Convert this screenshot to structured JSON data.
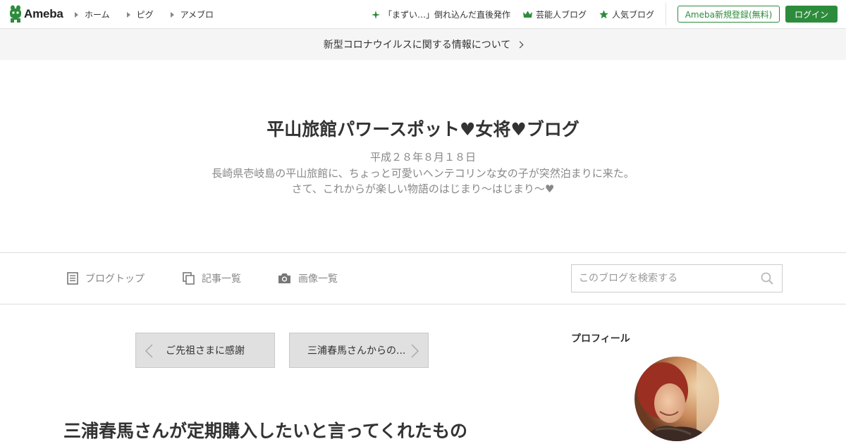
{
  "header": {
    "logo_text": "Ameba",
    "nav": [
      "ホーム",
      "ピグ",
      "アメブロ"
    ],
    "links": [
      {
        "label": "「まずい…」倒れ込んだ直後発作",
        "icon": "sparkle-icon"
      },
      {
        "label": "芸能人ブログ",
        "icon": "crown-icon"
      },
      {
        "label": "人気ブログ",
        "icon": "star-icon"
      }
    ],
    "register_label": "Ameba新規登録(無料)",
    "login_label": "ログイン"
  },
  "notice": {
    "text": "新型コロナウイルスに関する情報について"
  },
  "blog": {
    "title": "平山旅館パワースポット♥女将♥ブログ",
    "description": [
      "平成２８年８月１８日",
      "長崎県壱岐島の平山旅館に、ちょっと可愛いヘンテコリンな女の子が突然泊まりに来た。",
      "さて、これからが楽しい物語のはじまり～はじまり～♥"
    ]
  },
  "blognav": {
    "items": [
      {
        "label": "ブログトップ",
        "icon": "document-icon"
      },
      {
        "label": "記事一覧",
        "icon": "copy-icon"
      },
      {
        "label": "画像一覧",
        "icon": "camera-icon"
      }
    ],
    "search_placeholder": "このブログを検索する"
  },
  "pager": {
    "prev_label": "ご先祖さまに感謝",
    "next_label": "三浦春馬さんからの..."
  },
  "entry": {
    "title": "三浦春馬さんが定期購入したいと言ってくれたもの"
  },
  "sidebar": {
    "profile_heading": "プロフィール"
  },
  "colors": {
    "brand": "#2d8c3c",
    "notice_bg": "#f5f5f5",
    "pager_bg": "#e0e0e0"
  }
}
